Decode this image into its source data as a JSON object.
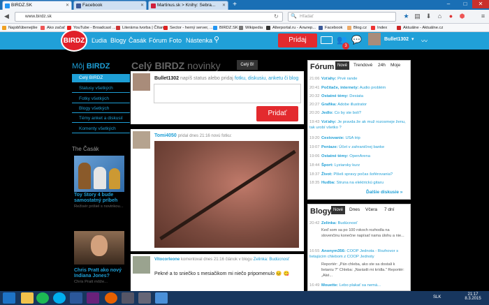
{
  "browser": {
    "tabs": [
      {
        "label": "BIRDZ.SK",
        "color": "#2196f3"
      },
      {
        "label": "Facebook",
        "color": "#3b5998"
      },
      {
        "label": "Martinus.sk > Knihy: Sebra...",
        "color": "#d01f3c"
      }
    ],
    "url": "www.birdz.sk",
    "search_placeholder": "Hľadať"
  },
  "bookmarks": [
    {
      "label": "Najobľúbenejšie",
      "color": "#f0a020"
    },
    {
      "label": "Ako začať",
      "color": "#e55"
    },
    {
      "label": "YouTube - Broadcast ...",
      "color": "#e22"
    },
    {
      "label": "Literárna tvorba | Čítan...",
      "color": "#c33"
    },
    {
      "label": "Sector - herný server, ...",
      "color": "#d22"
    },
    {
      "label": "BIRDZ.SK",
      "color": "#2196f3"
    },
    {
      "label": "Wikipedia",
      "color": "#777"
    },
    {
      "label": "Alterportal.ru - Альтер...",
      "color": "#333"
    },
    {
      "label": "Facebook",
      "color": "#3b5998"
    },
    {
      "label": "Blog.cz",
      "color": "#ea6"
    },
    {
      "label": "Index",
      "color": "#e33"
    },
    {
      "label": "Aktuálne - Aktuálne.cz",
      "color": "#c22"
    }
  ],
  "site": {
    "logo": "BIRDZ",
    "menu": [
      "Ľudia",
      "Blogy",
      "Časák",
      "Fórum",
      "Foto",
      "Nástenka"
    ],
    "pridaj": "Pridaj",
    "notif_count": "3",
    "username": "Bullet1302"
  },
  "left": {
    "title_prefix": "Môj ",
    "title_brand": "BIRDZ",
    "items": [
      "Celý BIRDZ",
      "Statusy všetkých",
      "Fotky všetkých",
      "Blogy všetkých",
      "Témy anket a diskusií",
      "Komenty všetkých"
    ],
    "casak_title": "The Časák",
    "articles": [
      {
        "title": "Toy Story 4 bude samostatný príbeh",
        "sub": "Režisér prišiel s novinkou..."
      },
      {
        "title": "Chris Pratt ako nový Indiana Jones?",
        "sub": "Chris Pratt môže..."
      }
    ]
  },
  "feed": {
    "title_brand": "Celý BIRDZ",
    "title_rest": " novinky",
    "cely_btn": "Celý B!",
    "status_user": "Bullet1302",
    "status_hint": "napíš status alebo pridaj",
    "status_links": "fotku, diskusiu, anketu či blog",
    "pridat": "Pridať",
    "post1_user": "Tomi4050",
    "post1_meta": "pridal dnes 21:16 novú fotku:",
    "post2_user": "Vitocorleone",
    "post2_meta": "komentoval dnes 21:16 článok v blogu",
    "post2_link": "Zelinka: Budúcnosť",
    "post2_text": "Pekné a to sniečko s mesiačikom mi niečo pripomenulo"
  },
  "forum": {
    "title": "Fórum",
    "tabs": [
      "Nové",
      "Trendové",
      "24h",
      "Moje"
    ],
    "rows": [
      {
        "time": "21:06",
        "cat": "Vzťahy:",
        "text": "Prvé rande"
      },
      {
        "time": "20:41",
        "cat": "Počítače, internety:",
        "text": "Audio problém"
      },
      {
        "time": "20:32",
        "cat": "Ostatné témy:",
        "text": "Desiata"
      },
      {
        "time": "20:27",
        "cat": "Grafika:",
        "text": "Adobe illustrator"
      },
      {
        "time": "20:20",
        "cat": "Jedlo:",
        "text": "Co by ste boli?"
      },
      {
        "time": "19:43",
        "cat": "Vzťahy:",
        "text": "Je pravda že ak muž rozosmeje ženu, tak urobí všetko ?"
      },
      {
        "time": "19:20",
        "cat": "Cestovanie:",
        "text": "USA trip"
      },
      {
        "time": "19:07",
        "cat": "Peniaze:",
        "text": "Účet v zahraničnej banke"
      },
      {
        "time": "19:06",
        "cat": "Ostatné témy:",
        "text": "OpenArena"
      },
      {
        "time": "18:44",
        "cat": "Šport:",
        "text": "Lyziarsky kurz"
      },
      {
        "time": "18:37",
        "cat": "Život:",
        "text": "Plšeš spravy počas šoférovania?"
      },
      {
        "time": "18:35",
        "cat": "Hudba:",
        "text": "Struna na elektrickú gitaru"
      }
    ],
    "more": "Ďalšie diskusie »"
  },
  "blogs": {
    "title": "Blogy",
    "tabs": [
      "Nové",
      "Dnes",
      "Včera",
      "7 dní"
    ],
    "rows": [
      {
        "time": "20:42",
        "user": "Zelinka:",
        "title": "Budúcnosť",
        "text": "Keď som sa po 100 rokoch rozhodla na slovenčinu konečne napísať nama úlohu a nie..."
      },
      {
        "time": "16:55",
        "user": "Anonym356:",
        "title": "COOP Jednota - Rozhovor s lietajúcim chlebom z COOP Jednoty",
        "text": "Reportér: „Pán chleba, ako ste sa dostali k lietaniu ?\" Chleba: „Narástli mi krídla.\" Reportér: „Aké..."
      },
      {
        "time": "16:49",
        "user": "Mouette:",
        "title": "Lebo plakať sa nemá...",
        "text": ""
      }
    ]
  },
  "taskbar": {
    "lang": "SLK",
    "time": "21:17",
    "date": "8.3.2015"
  }
}
